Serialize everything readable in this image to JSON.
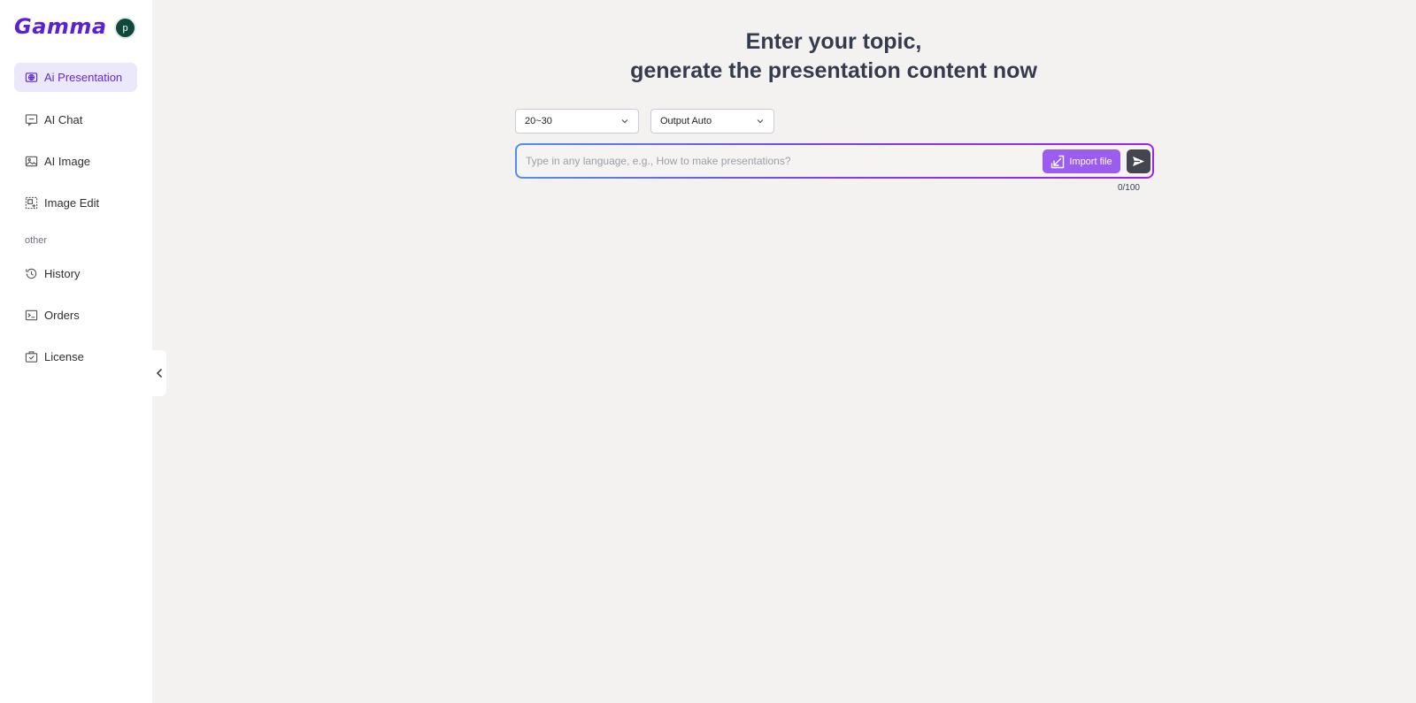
{
  "brand": {
    "logo_text": "Gamma",
    "avatar_initial": "p",
    "accent": "#5b21d6"
  },
  "sidebar": {
    "items": [
      {
        "label": "Ai Presentation",
        "icon": "globe-grid-icon",
        "active": true
      },
      {
        "label": "AI Chat",
        "icon": "chat-icon"
      },
      {
        "label": "AI Image",
        "icon": "image-icon"
      },
      {
        "label": "Image Edit",
        "icon": "image-edit-icon"
      }
    ],
    "section_label": "other",
    "other_items": [
      {
        "label": "History",
        "icon": "history-icon"
      },
      {
        "label": "Orders",
        "icon": "orders-icon"
      },
      {
        "label": "License",
        "icon": "license-icon"
      }
    ]
  },
  "main": {
    "headline_line1": "Enter your topic,",
    "headline_line2": "generate the presentation content now",
    "page_count_select": "20~30",
    "output_select": "Output Auto",
    "input_placeholder": "Type in any language, e.g., How to make presentations?",
    "input_value": "",
    "import_label": "Import file",
    "counter": "0/100"
  }
}
